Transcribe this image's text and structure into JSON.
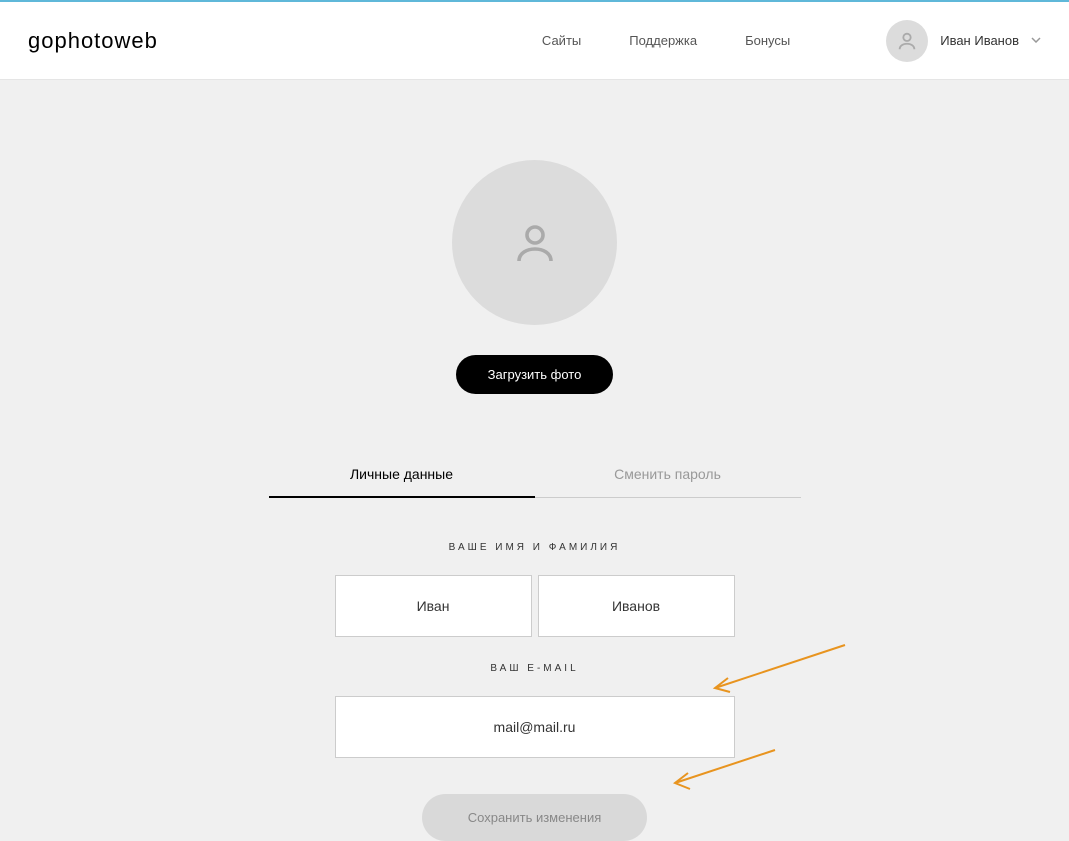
{
  "header": {
    "logo": "gophotoweb",
    "nav": {
      "sites": "Сайты",
      "support": "Поддержка",
      "bonuses": "Бонусы"
    },
    "user_name": "Иван Иванов"
  },
  "profile": {
    "upload_label": "Загрузить фото"
  },
  "tabs": {
    "personal": "Личные данные",
    "password": "Сменить пароль"
  },
  "form": {
    "name_label": "ВАШЕ ИМЯ И ФАМИЛИЯ",
    "first_name": "Иван",
    "last_name": "Иванов",
    "email_label": "ВАШ E-MAIL",
    "email": "mail@mail.ru",
    "save_label": "Сохранить изменения"
  }
}
